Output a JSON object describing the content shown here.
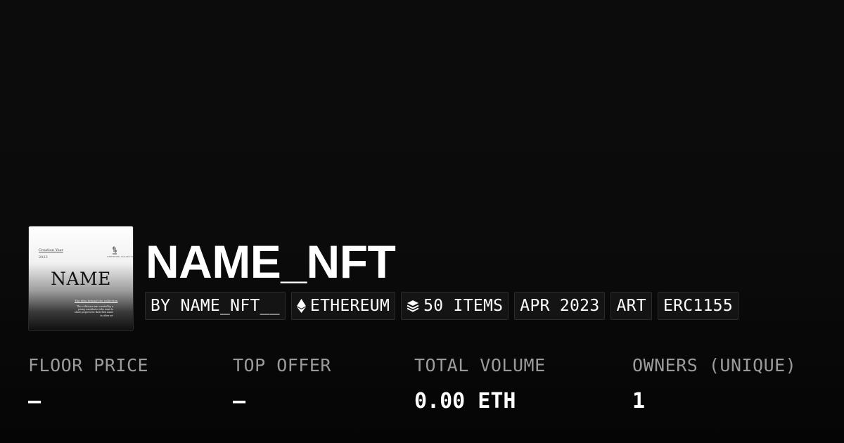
{
  "thumbnail": {
    "creator_label": "Creation Year",
    "year": "2023",
    "logo_text": "CERTIFIED COLLECTION",
    "name": "NAME",
    "idea_text": "The idea behind the collection",
    "description": "This collection was created by a young contributor who want to share projects for their first name in other art"
  },
  "collection": {
    "title": "NAME_NFT"
  },
  "tags": {
    "creator": "BY NAME_NFT__",
    "chain": "ETHEREUM",
    "items": "50 ITEMS",
    "date": "APR 2023",
    "category": "ART",
    "standard": "ERC1155"
  },
  "stats": [
    {
      "label": "FLOOR PRICE",
      "value": "—"
    },
    {
      "label": "TOP OFFER",
      "value": "—"
    },
    {
      "label": "TOTAL VOLUME",
      "value": "0.00 ETH"
    },
    {
      "label": "OWNERS (UNIQUE)",
      "value": "1"
    }
  ],
  "icons": {
    "chain": "ethereum-icon",
    "items": "layers-icon"
  },
  "colors": {
    "background": "#0b0b0b",
    "tag_background": "#141414",
    "tag_border": "#2b2b2b",
    "label": "#9b9b9b",
    "text": "#ffffff"
  }
}
